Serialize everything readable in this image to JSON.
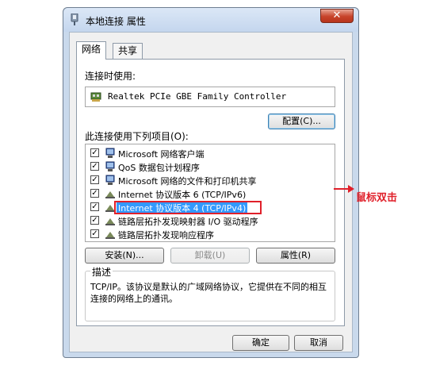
{
  "window": {
    "title": "本地连接 属性",
    "close_label": "✕"
  },
  "tabs": [
    {
      "label": "网络",
      "active": true
    },
    {
      "label": "共享",
      "active": false
    }
  ],
  "connect_using_label": "连接时使用:",
  "adapter_name": "Realtek PCIe GBE Family Controller",
  "configure_button": "配置(C)...",
  "items_label": "此连接使用下列项目(O):",
  "items": [
    {
      "label": "Microsoft 网络客户端",
      "checked": true,
      "icon": "network-client-icon"
    },
    {
      "label": "QoS 数据包计划程序",
      "checked": true,
      "icon": "qos-icon"
    },
    {
      "label": "Microsoft 网络的文件和打印机共享",
      "checked": true,
      "icon": "file-share-icon"
    },
    {
      "label": "Internet 协议版本 6 (TCP/IPv6)",
      "checked": true,
      "icon": "protocol-icon"
    },
    {
      "label": "Internet 协议版本 4 (TCP/IPv4)",
      "checked": true,
      "icon": "protocol-icon",
      "selected": true
    },
    {
      "label": "链路层拓扑发现映射器 I/O 驱动程序",
      "checked": true,
      "icon": "protocol-icon"
    },
    {
      "label": "链路层拓扑发现响应程序",
      "checked": true,
      "icon": "protocol-icon"
    }
  ],
  "buttons": {
    "install": "安装(N)...",
    "uninstall": "卸载(U)",
    "properties": "属性(R)"
  },
  "description": {
    "legend": "描述",
    "text": "TCP/IP。该协议是默认的广域网络协议，它提供在不同的相互连接的网络上的通讯。"
  },
  "dialog_buttons": {
    "ok": "确定",
    "cancel": "取消"
  },
  "annotation": "鼠标双击",
  "colors": {
    "selection": "#3399ff",
    "annotation": "#e0202a"
  }
}
